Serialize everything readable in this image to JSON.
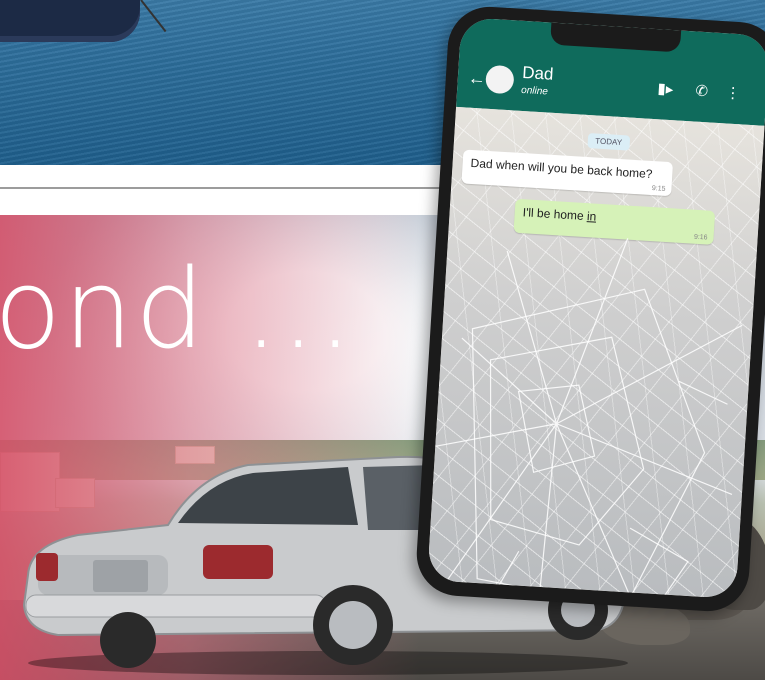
{
  "headline": {
    "text": "ond ..."
  },
  "chat": {
    "contact_name": "Dad",
    "contact_status": "online",
    "date_divider": "TODAY",
    "messages": [
      {
        "direction": "incoming",
        "text": "Dad when will you be back home?",
        "time": "9:15"
      },
      {
        "direction": "outgoing",
        "text_prefix": "I'll be home ",
        "text_typed": "in",
        "time": "9:16"
      }
    ],
    "icons": [
      "back-arrow-icon",
      "video-call-icon",
      "phone-call-icon",
      "more-options-icon"
    ]
  },
  "colors": {
    "chat_header": "#0f6b5c",
    "outgoing_bubble": "#d6f2b8",
    "pink_overlay": "#d64f67",
    "car_body": "#c9cbcd"
  }
}
